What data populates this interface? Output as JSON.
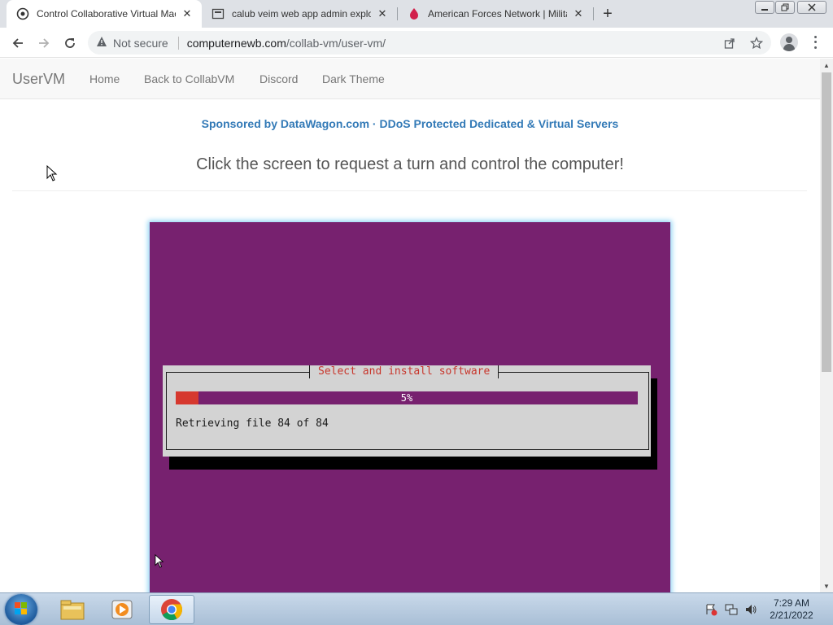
{
  "browser": {
    "tabs": [
      {
        "title": "Control Collaborative Virtual Mac",
        "icon": "collabvm-favicon",
        "active": true
      },
      {
        "title": "calub veim web app admin exploi",
        "icon": "page-favicon",
        "active": false
      },
      {
        "title": "American Forces Network | Milita",
        "icon": "afn-favicon",
        "active": false
      }
    ],
    "new_tab_glyph": "+",
    "security_label": "Not secure",
    "url_host": "computernewb.com",
    "url_path": "/collab-vm/user-vm/"
  },
  "page": {
    "brand": "UserVM",
    "nav": [
      "Home",
      "Back to CollabVM",
      "Discord",
      "Dark Theme"
    ],
    "sponsor": "Sponsored by DataWagon.com · DDoS Protected Dedicated & Virtual Servers",
    "lead": "Click the screen to request a turn and control the computer!"
  },
  "vm": {
    "background_color": "#77216f",
    "dialog_title": "Select and install software",
    "progress_percent": 5,
    "progress_label": "5%",
    "status_text": "Retrieving file 84 of 84"
  },
  "taskbar": {
    "pinned": [
      "file-explorer-icon",
      "media-player-icon",
      "chrome-icon"
    ],
    "time": "7:29 AM",
    "date": "2/21/2022"
  },
  "colors": {
    "link": "#337ab7",
    "progress_fill": "#d6382e",
    "dialog_title": "#c8372d"
  }
}
